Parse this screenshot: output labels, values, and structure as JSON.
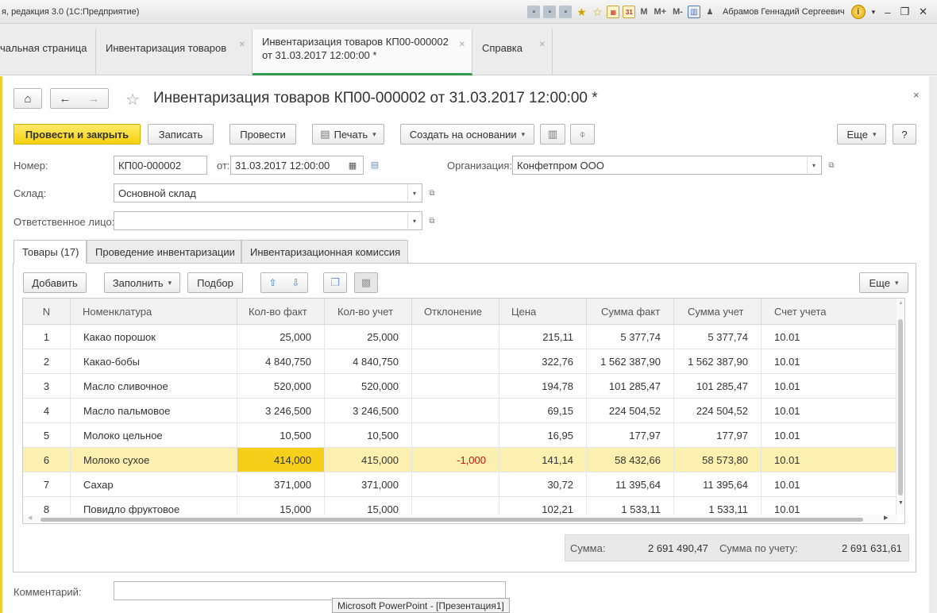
{
  "window": {
    "title": "я, редакция 3.0  (1С:Предприятие)",
    "user": "Абрамов Геннадий Сергеевич",
    "m_labels": [
      "M",
      "M+",
      "M-"
    ]
  },
  "tabs": [
    {
      "label": "чальная страница"
    },
    {
      "label": "Инвентаризация товаров"
    },
    {
      "label_line1": "Инвентаризация товаров КП00-000002",
      "label_line2": "от 31.03.2017 12:00:00 *"
    },
    {
      "label": "Справка"
    }
  ],
  "form": {
    "title": "Инвентаризация товаров КП00-000002 от 31.03.2017 12:00:00 *",
    "close_glyph": "×",
    "toolbar": {
      "post_close": "Провести и закрыть",
      "save": "Записать",
      "post": "Провести",
      "print": "Печать",
      "create_based": "Создать на основании",
      "more": "Еще",
      "help": "?"
    },
    "fields": {
      "number_label": "Номер:",
      "number_value": "КП00-000002",
      "date_label": "от:",
      "date_value": "31.03.2017 12:00:00",
      "org_label": "Организация:",
      "org_value": "Конфетпром ООО",
      "warehouse_label": "Склад:",
      "warehouse_value": "Основной склад",
      "responsible_label": "Ответственное лицо:",
      "responsible_value": "",
      "comment_label": "Комментарий:",
      "comment_value": ""
    },
    "inner_tabs": [
      "Товары (17)",
      "Проведение инвентаризации",
      "Инвентаризационная комиссия"
    ],
    "table_toolbar": {
      "add": "Добавить",
      "fill": "Заполнить",
      "select": "Подбор",
      "more": "Еще"
    },
    "columns": [
      "N",
      "Номенклатура",
      "Кол-во факт",
      "Кол-во учет",
      "Отклонение",
      "Цена",
      "Сумма факт",
      "Сумма учет",
      "Счет учета"
    ],
    "rows": [
      {
        "n": "1",
        "name": "Какао порошок",
        "qty_fact": "25,000",
        "qty_acc": "25,000",
        "dev": "",
        "price": "215,11",
        "sum_fact": "5 377,74",
        "sum_acc": "5 377,74",
        "account": "10.01"
      },
      {
        "n": "2",
        "name": "Какао-бобы",
        "qty_fact": "4 840,750",
        "qty_acc": "4 840,750",
        "dev": "",
        "price": "322,76",
        "sum_fact": "1 562 387,90",
        "sum_acc": "1 562 387,90",
        "account": "10.01"
      },
      {
        "n": "3",
        "name": "Масло сливочное",
        "qty_fact": "520,000",
        "qty_acc": "520,000",
        "dev": "",
        "price": "194,78",
        "sum_fact": "101 285,47",
        "sum_acc": "101 285,47",
        "account": "10.01"
      },
      {
        "n": "4",
        "name": "Масло пальмовое",
        "qty_fact": "3 246,500",
        "qty_acc": "3 246,500",
        "dev": "",
        "price": "69,15",
        "sum_fact": "224 504,52",
        "sum_acc": "224 504,52",
        "account": "10.01"
      },
      {
        "n": "5",
        "name": "Молоко цельное",
        "qty_fact": "10,500",
        "qty_acc": "10,500",
        "dev": "",
        "price": "16,95",
        "sum_fact": "177,97",
        "sum_acc": "177,97",
        "account": "10.01"
      },
      {
        "n": "6",
        "name": "Молоко сухое",
        "qty_fact": "414,000",
        "qty_acc": "415,000",
        "dev": "-1,000",
        "price": "141,14",
        "sum_fact": "58 432,66",
        "sum_acc": "58 573,80",
        "account": "10.01"
      },
      {
        "n": "7",
        "name": "Сахар",
        "qty_fact": "371,000",
        "qty_acc": "371,000",
        "dev": "",
        "price": "30,72",
        "sum_fact": "11 395,64",
        "sum_acc": "11 395,64",
        "account": "10.01"
      },
      {
        "n": "8",
        "name": "Повидло фруктовое",
        "qty_fact": "15,000",
        "qty_acc": "15,000",
        "dev": "",
        "price": "102,21",
        "sum_fact": "1 533,11",
        "sum_acc": "1 533,11",
        "account": "10.01"
      }
    ],
    "totals": {
      "sum_label": "Сумма:",
      "sum_value": "2 691 490,47",
      "sum_acc_label": "Сумма по учету:",
      "sum_acc_value": "2 691 631,61"
    }
  },
  "taskbar_popup": "Microsoft PowerPoint - [Презентация1]",
  "colors": {
    "primary_button": "#f5d20c",
    "selected_row": "#fbf0b0",
    "current_cell": "#f5cf1a",
    "negative": "#d01010",
    "active_tab_underline": "#2d9b47"
  }
}
